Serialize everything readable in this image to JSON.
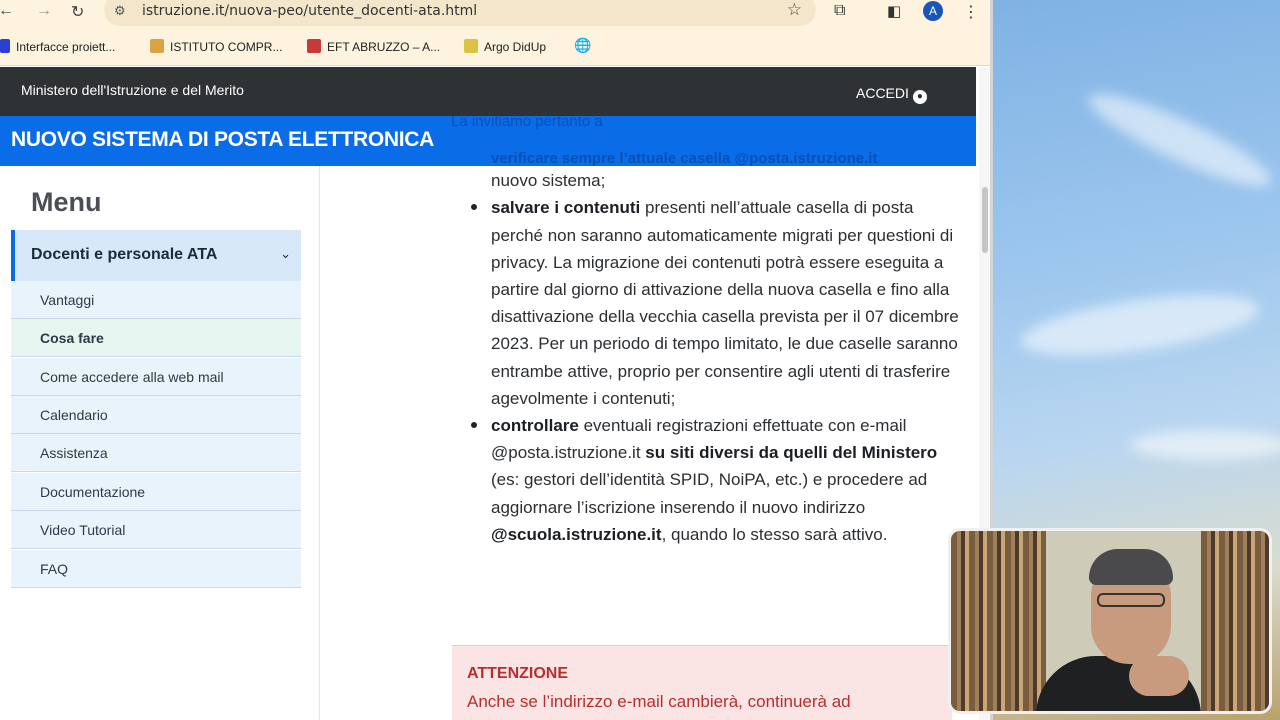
{
  "browser": {
    "url": "istruzione.it/nuova-peo/utente_docenti-ata.html",
    "avatar_letter": "A",
    "bookmarks": [
      {
        "label": "Interfacce proiett...",
        "color": "#2b3fd6"
      },
      {
        "label": "ISTITUTO COMPR...",
        "color": "#d9a441"
      },
      {
        "label": "EFT ABRUZZO – A...",
        "color": "#c83a3a"
      },
      {
        "label": "Argo DidUp",
        "color": "#d9c341"
      }
    ]
  },
  "site": {
    "ministry": "Ministero dell'Istruzione e del Merito",
    "login": "ACCEDI",
    "banner_title": "NUOVO SISTEMA DI POSTA ELETTRONICA",
    "ghost_lines": [
      "La invitiamo pertanto a",
      "verificare sempre l’attuale casella @posta.istruzione.it"
    ]
  },
  "menu": {
    "title": "Menu",
    "section": "Docenti e personale ATA",
    "items": [
      "Vantaggi",
      "Cosa fare",
      "Come accedere alla web mail",
      "Calendario",
      "Assistenza",
      "Documentazione",
      "Video Tutorial",
      "FAQ"
    ],
    "current_index": 1
  },
  "content": {
    "item1_rest": "perché lì riceverà informazioni dettagliate sul passaggio al nuovo sistema;",
    "item2_bold": "salvare i contenuti",
    "item2_text": " presenti nell’attuale casella di posta perché non saranno automaticamente migrati per questioni di privacy. La migrazione dei contenuti potrà essere eseguita a partire dal giorno di attivazione della nuova casella e fino alla disattivazione della vecchia casella prevista per il 07 dicembre 2023. Per un periodo di tempo limitato, le due caselle saranno entrambe attive, proprio per consentire agli utenti di trasferire agevolmente i contenuti;",
    "item3_bold": "controllare",
    "item3_text_a": " eventuali registrazioni effettuate con e-mail @posta.istruzione.it ",
    "item3_bold_b": "su siti diversi da quelli del Ministero",
    "item3_text_b": "  (es: gestori dell’identità SPID, NoiPA, etc.) e procedere ad aggiornare l’iscrizione inserendo il nuovo indirizzo ",
    "item3_bold_c": "@scuola.istruzione.it",
    "item3_text_c": ", quando lo stesso sarà attivo."
  },
  "alert": {
    "title": "ATTENZIONE",
    "text": "Anche se l’indirizzo e-mail cambierà, continuerà ad"
  }
}
